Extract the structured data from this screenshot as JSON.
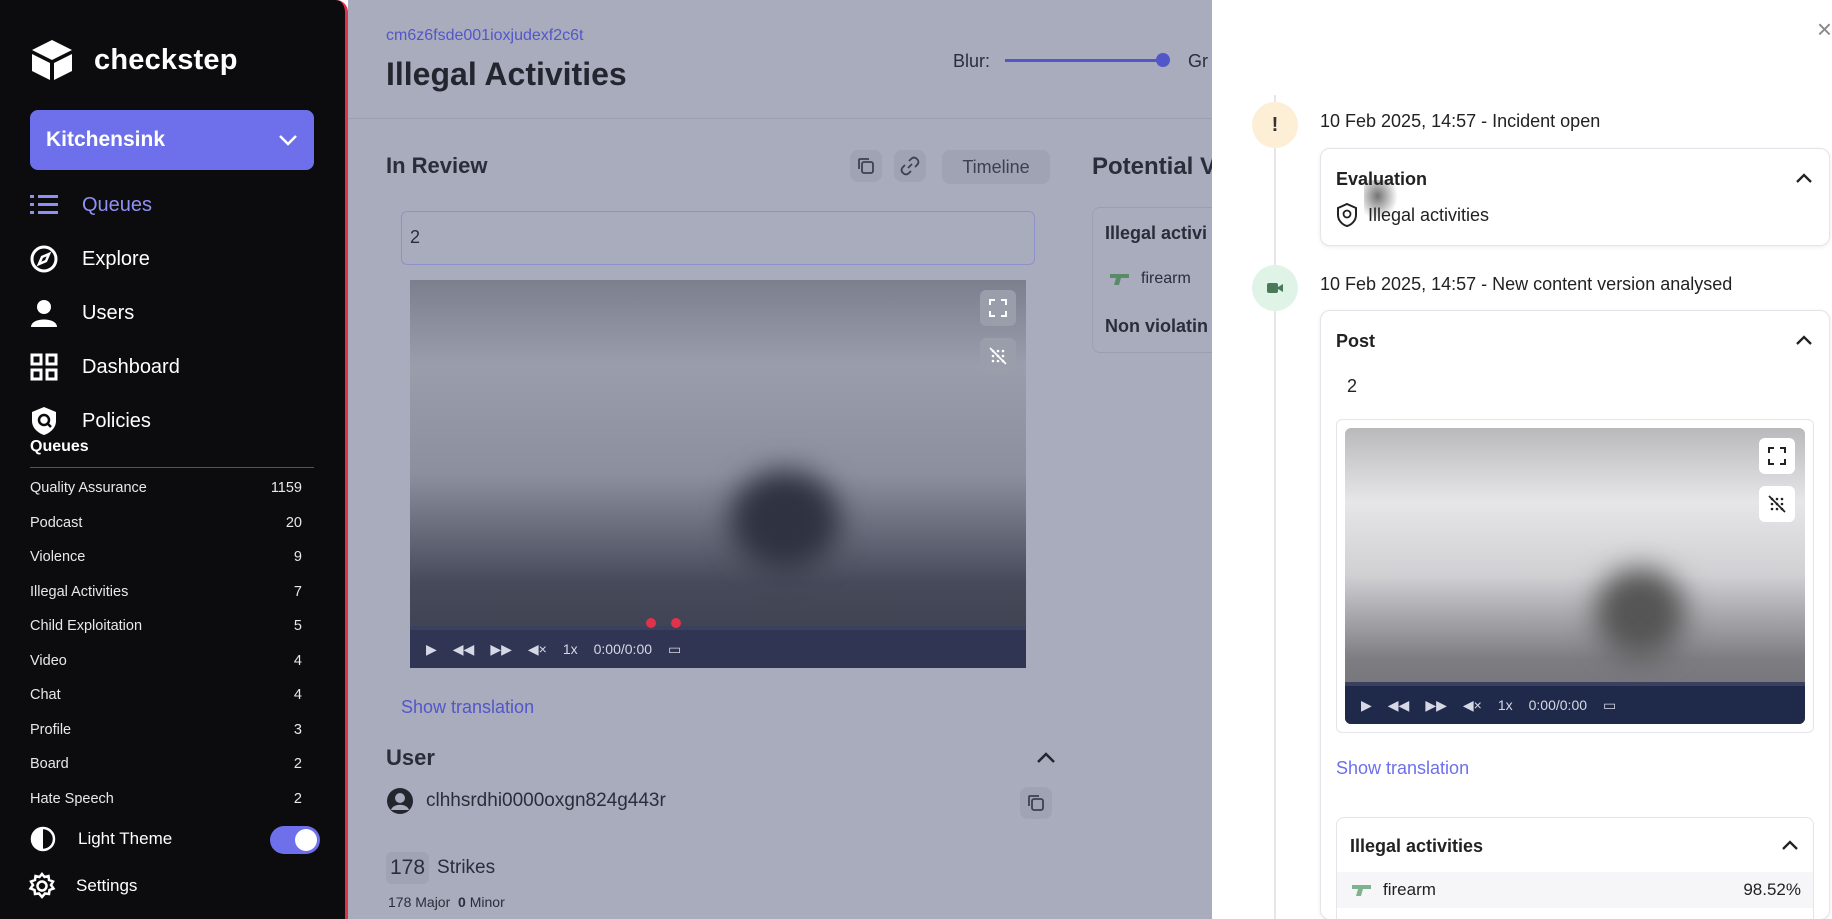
{
  "sidebar": {
    "brand": "checkstep",
    "workspace": "Kitchensink",
    "nav": [
      {
        "label": "Queues",
        "icon": "list-icon",
        "active": true
      },
      {
        "label": "Explore",
        "icon": "compass-icon",
        "active": false
      },
      {
        "label": "Users",
        "icon": "user-icon",
        "active": false
      },
      {
        "label": "Dashboard",
        "icon": "grid-icon",
        "active": false
      },
      {
        "label": "Policies",
        "icon": "policy-shield-icon",
        "active": false
      }
    ],
    "queues_heading": "Queues",
    "queues": [
      {
        "name": "Quality Assurance",
        "count": "1159"
      },
      {
        "name": "Podcast",
        "count": "20"
      },
      {
        "name": "Violence",
        "count": "9"
      },
      {
        "name": "Illegal Activities",
        "count": "7"
      },
      {
        "name": "Child Exploitation",
        "count": "5"
      },
      {
        "name": "Video",
        "count": "4"
      },
      {
        "name": "Chat",
        "count": "4"
      },
      {
        "name": "Profile",
        "count": "3"
      },
      {
        "name": "Board",
        "count": "2"
      },
      {
        "name": "Hate Speech",
        "count": "2"
      }
    ],
    "theme_label": "Light Theme",
    "settings_label": "Settings",
    "accent": "#6d70ea"
  },
  "main": {
    "case_id": "cm6z6fsde001ioxjudexf2c6t",
    "title": "Illegal Activities",
    "blur_label": "Blur:",
    "blur_level": 1.0,
    "gr_label": "Gr",
    "in_review": "In Review",
    "timeline_button": "Timeline",
    "content_text": "2",
    "video": {
      "speed": "1x",
      "time": "0:00/0:00"
    },
    "show_translation": "Show translation",
    "user_heading": "User",
    "user_id": "clhhsrdhi0000oxgn824g443r",
    "strikes_count": "178",
    "strikes_label": "Strikes",
    "major_count": "178",
    "major_label": "Major",
    "minor_count": "0",
    "minor_label": "Minor",
    "potential_title": "Potential V",
    "potential_card": {
      "title": "Illegal activi",
      "item": "firearm",
      "non_violating": "Non violatin"
    }
  },
  "drawer": {
    "close": "×",
    "event1": {
      "time": "10 Feb 2025, 14:57 - Incident open",
      "card_title": "Evaluation",
      "tag": "Illegal activities",
      "badge": "!"
    },
    "event2": {
      "time": "10 Feb 2025, 14:57 - New content version analysed",
      "card_title": "Post",
      "content_text": "2",
      "video": {
        "speed": "1x",
        "time": "0:00/0:00"
      },
      "show_translation": "Show translation",
      "classification_title": "Illegal activities",
      "classification_item": "firearm",
      "classification_score": "98.52%"
    }
  }
}
